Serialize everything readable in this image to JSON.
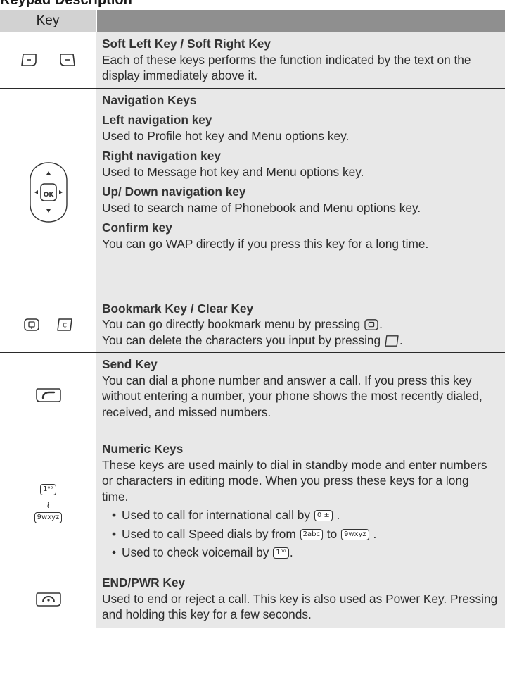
{
  "page": {
    "title": "Keypad Description"
  },
  "table": {
    "header_key": "Key",
    "rows": {
      "soft": {
        "title": "Soft Left Key / Soft Right Key",
        "text": "Each of these keys performs the function indicated by the text on the display immediately above it."
      },
      "nav": {
        "title": "Navigation Keys",
        "left_title": "Left navigation key",
        "left_text": "Used to Profile hot key and Menu options key.",
        "right_title": "Right navigation key",
        "right_text": "Used to Message hot key and Menu options key.",
        "updown_title": "Up/ Down navigation key",
        "updown_text": "Used to search name of Phonebook and Menu options key.",
        "confirm_title": "Confirm key",
        "confirm_text": "You can go WAP directly if you press this key for a long time.",
        "ok_label": "OK"
      },
      "bookmark": {
        "title": "Bookmark Key / Clear Key",
        "line1": "You can go directly bookmark menu by pressing",
        "line2": "You can delete the characters you input by pressing",
        "period": ".",
        "clear_label": "C"
      },
      "send": {
        "title": "Send Key",
        "text": "You can dial a phone number and answer a call. If you press this key without entering a number, your phone shows the most recently dialed, received, and missed numbers."
      },
      "numeric": {
        "title": "Numeric Keys",
        "text": "These keys are used mainly to dial in standby mode and enter numbers or characters in editing mode. When you press these keys for a long time.",
        "bullet1": "Used to call for international call by",
        "bullet2_pre": "Used to call Speed dials by from",
        "bullet2_mid": "to",
        "bullet3": "Used to check voicemail by",
        "key_1": "1ᵒᵒ",
        "key_0": "0 ±",
        "key_2": "2abc",
        "key_9": "9wxyz",
        "range": "≀",
        "period": "."
      },
      "end": {
        "title": "END/PWR Key",
        "text": "Used to end or reject a call. This key is also used as Power Key. Pressing and holding this key for a few seconds."
      }
    }
  }
}
